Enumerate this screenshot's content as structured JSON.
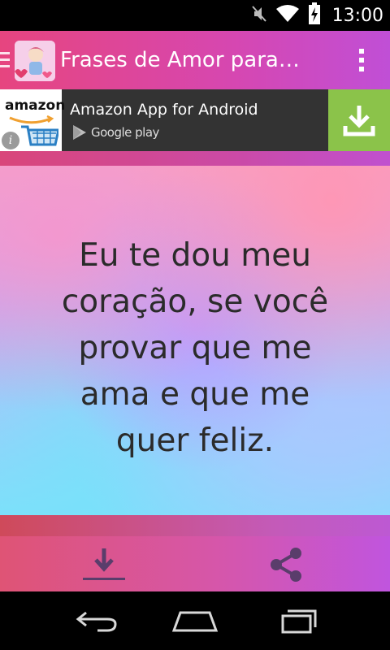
{
  "status_bar": {
    "time": "13:00",
    "icons": [
      "mute-icon",
      "wifi-icon",
      "battery-charging-icon"
    ]
  },
  "action_bar": {
    "title": "Frases de Amor para…",
    "drawer_icon": "drawer-indicator-icon",
    "overflow_icon": "overflow-menu-icon",
    "accent_color": "#d647b1"
  },
  "ad": {
    "brand": "amazon",
    "title": "Amazon App for Android",
    "store": "Google play",
    "download_color": "#8bc34a"
  },
  "quote": {
    "lines": [
      "Eu te dou meu",
      "coração, se você",
      "provar que me",
      "ama e que me",
      "quer feliz."
    ]
  },
  "bottom_bar": {
    "buttons": [
      "download-icon",
      "share-icon"
    ]
  },
  "nav_bar": {
    "buttons": [
      "back-icon",
      "home-icon",
      "recent-apps-icon"
    ]
  }
}
